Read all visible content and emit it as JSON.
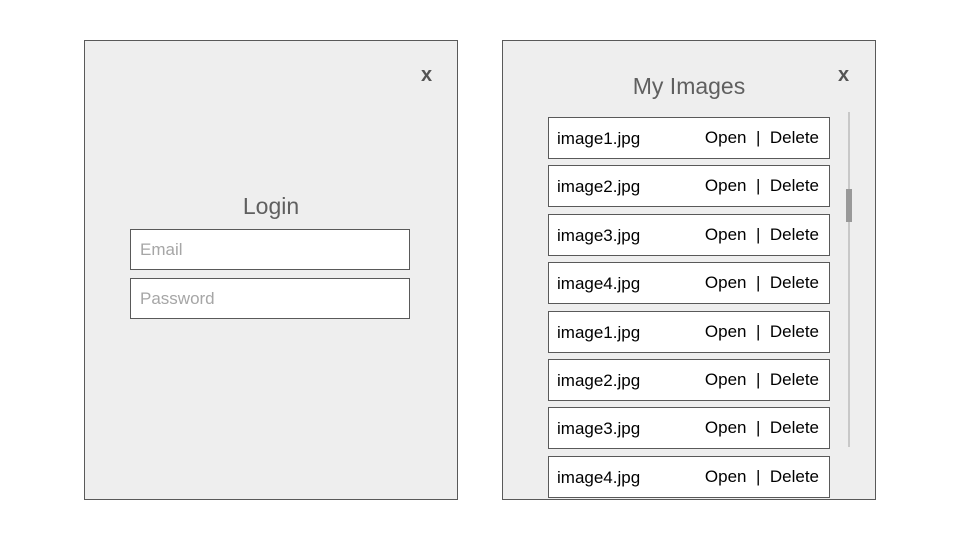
{
  "login": {
    "close_label": "x",
    "title": "Login",
    "email_placeholder": "Email",
    "password_placeholder": "Password"
  },
  "images": {
    "close_label": "x",
    "title": "My Images",
    "open_label": "Open",
    "separator": "|",
    "delete_label": "Delete",
    "files": [
      "image1.jpg",
      "image2.jpg",
      "image3.jpg",
      "image4.jpg",
      "image1.jpg",
      "image2.jpg",
      "image3.jpg",
      "image4.jpg"
    ]
  },
  "colors": {
    "panel_background": "#eeeeee",
    "panel_border": "#595959",
    "placeholder_text": "#a6a6a6",
    "title_text": "#5f5f5f"
  }
}
